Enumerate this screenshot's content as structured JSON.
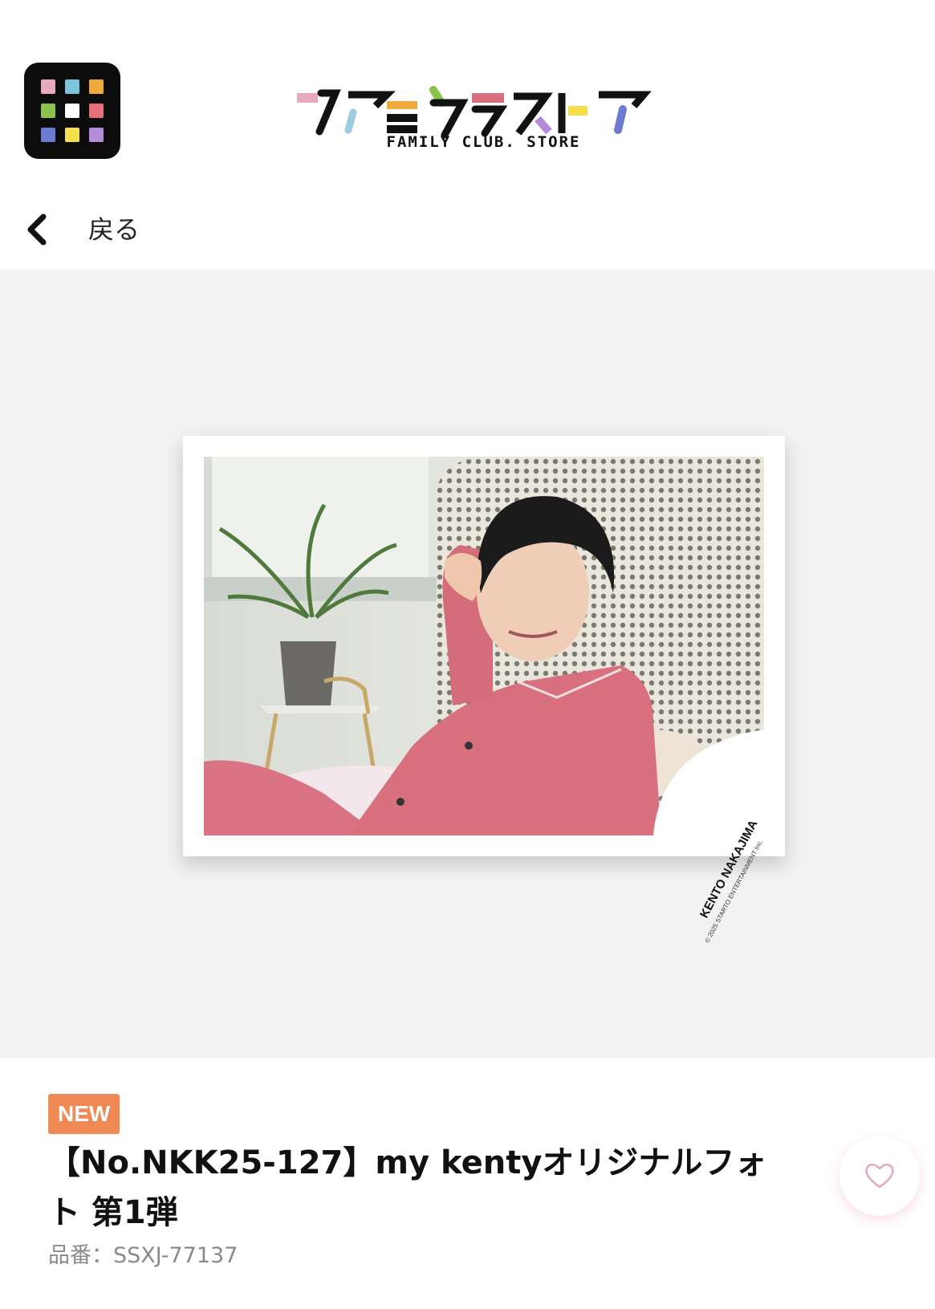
{
  "header": {
    "logo_text": "ファミクラストア",
    "logo_subtitle": "FAMILY CLUB. STORE",
    "back_label": "戻る",
    "menu_colors": [
      "#e8a9bd",
      "#7cc6dd",
      "#f0a93c",
      "#8bc34a",
      "#ffffff",
      "#e76f7b",
      "#6c7bd1",
      "#f5e04a",
      "#b48bd6"
    ]
  },
  "photo": {
    "watermark_name": "KENTO NAKAJIMA",
    "watermark_copy": "© 2025 STARTO ENTERTAINMENT Inc."
  },
  "product": {
    "badge": "NEW",
    "title": "【No.NKK25-127】my kentyオリジナルフォト 第1弾",
    "sku": "品番：SSXJ-77137"
  },
  "colors": {
    "badge": "#f08a55",
    "heart": "#e9a6c2",
    "photo_bg": "#f2f2f2"
  }
}
